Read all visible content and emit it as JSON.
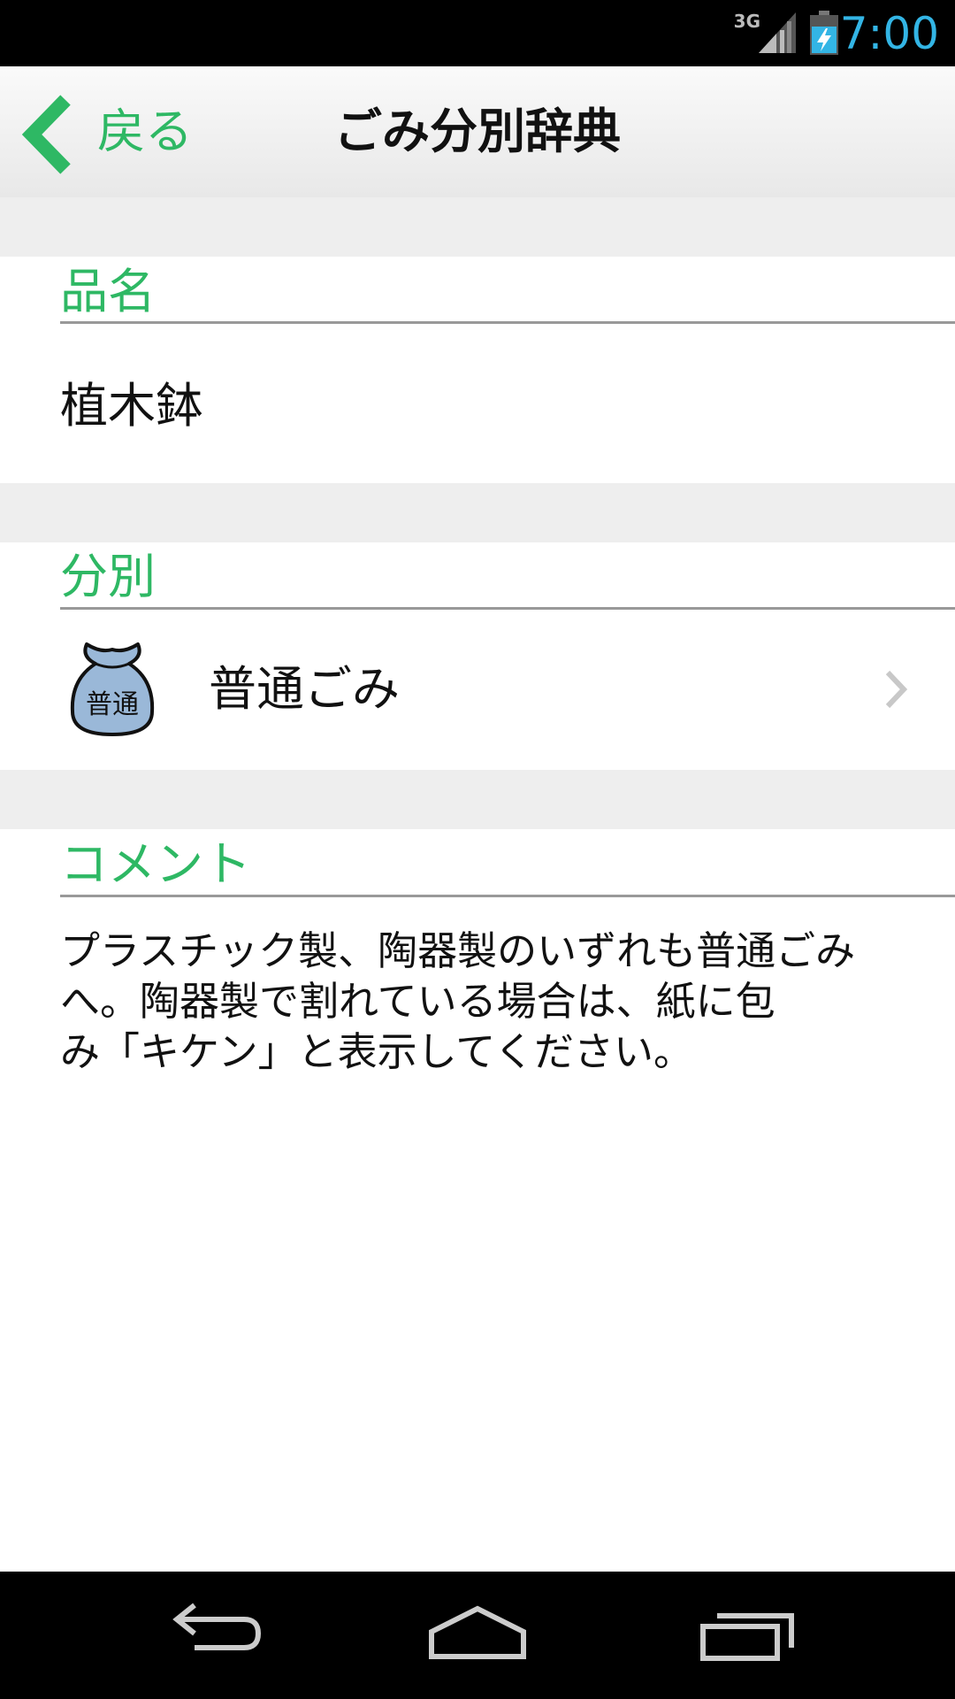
{
  "status_bar": {
    "network": "3G",
    "time": "7:00"
  },
  "header": {
    "back_label": "戻る",
    "title": "ごみ分別辞典"
  },
  "sections": {
    "item": {
      "label": "品名",
      "value": "植木鉢"
    },
    "category": {
      "label": "分別",
      "icon_text": "普通",
      "value": "普通ごみ"
    },
    "comment": {
      "label": "コメント",
      "text": "プラスチック製、陶器製のいずれも普通ごみ\nへ。陶器製で割れている場合は、紙に包\nみ「キケン」と表示してください。"
    }
  },
  "colors": {
    "accent": "#2eb864",
    "time": "#33b5e5",
    "gap": "#eeeeee",
    "bag": "#9ab8d8"
  }
}
